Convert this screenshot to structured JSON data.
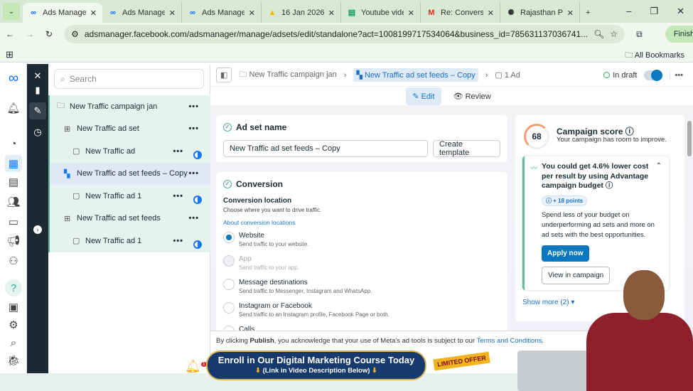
{
  "browser": {
    "tabs": [
      {
        "title": "Ads Manager",
        "icon": "meta-icon",
        "active": true
      },
      {
        "title": "Ads Manager",
        "icon": "meta-icon"
      },
      {
        "title": "Ads Manager",
        "icon": "meta-icon"
      },
      {
        "title": "16 Jan 2026 -",
        "icon": "google-drive-icon"
      },
      {
        "title": "Youtube video",
        "icon": "google-sheets-icon"
      },
      {
        "title": "Re: Conversati",
        "icon": "gmail-icon"
      },
      {
        "title": "Rajasthan PIN",
        "icon": "openai-icon"
      }
    ],
    "url": "adsmanager.facebook.com/adsmanager/manage/adsets/edit/standalone?act=1008199717534064&business_id=785631137036741...",
    "profile_button": "Finish",
    "all_bookmarks": "All Bookmarks"
  },
  "tree": {
    "search_placeholder": "Search",
    "items": [
      {
        "label": "New Traffic campaign jan",
        "type": "campaign"
      },
      {
        "label": "New Traffic ad set",
        "type": "adset"
      },
      {
        "label": "New Traffic ad",
        "type": "ad"
      },
      {
        "label": "New Traffic ad set feeds – Copy",
        "type": "adset",
        "selected": true
      },
      {
        "label": "New Traffic ad 1",
        "type": "ad"
      },
      {
        "label": "New Traffic ad set feeds",
        "type": "adset"
      },
      {
        "label": "New Traffic ad 1",
        "type": "ad"
      }
    ]
  },
  "header": {
    "breadcrumb": [
      "New Traffic campaign jan",
      "New Traffic ad set feeds – Copy",
      "1 Ad"
    ],
    "status": "In draft",
    "toggle_on": true,
    "edit": "Edit",
    "review": "Review"
  },
  "adset_name": {
    "title": "Ad set name",
    "value": "New Traffic ad set feeds – Copy",
    "create_template": "Create template"
  },
  "conversion": {
    "title": "Conversion",
    "location_label": "Conversion location",
    "location_help": "Choose where you want to drive traffic.",
    "about_link": "About conversion locations",
    "options": [
      {
        "label": "Website",
        "desc": "Send traffic to your website.",
        "selected": true
      },
      {
        "label": "App",
        "desc": "Send traffic to your app.",
        "disabled": true
      },
      {
        "label": "Message destinations",
        "desc": "Send traffic to Messenger, Instagram and WhatsApp."
      },
      {
        "label": "Instagram or Facebook",
        "desc": "Send traffic to an Instagram profile, Facebook Page or both."
      },
      {
        "label": "Calls",
        "desc": ""
      }
    ]
  },
  "score": {
    "value": "68",
    "title": "Campaign score",
    "subtitle": "Your campaign has room to improve.",
    "rec_title": "You could get 4.6% lower cost per result by using Advantage campaign budget",
    "points": "+ 18 points",
    "rec_body": "Spend less of your budget on underperforming ad sets and more on ad sets with the best opportunities.",
    "apply": "Apply now",
    "view": "View in campaign",
    "show_more": "Show more (2)"
  },
  "footer": {
    "pre": "By clicking ",
    "bold": "Publish",
    "mid": ", you acknowledge that your use of Meta's ad tools is subject to our ",
    "link": "Terms and Conditions",
    "end": "."
  },
  "overlay": {
    "banner_line1": "Enroll in Our Digital Marketing Course Today",
    "banner_line2": "(Link in Video Description Below)",
    "offer": "LIMITED OFFER",
    "bell_count": "1"
  },
  "colors": {
    "accent": "#0a78be",
    "tree_bg": "#e5f3ee",
    "dark_rail": "#1c2b33"
  }
}
